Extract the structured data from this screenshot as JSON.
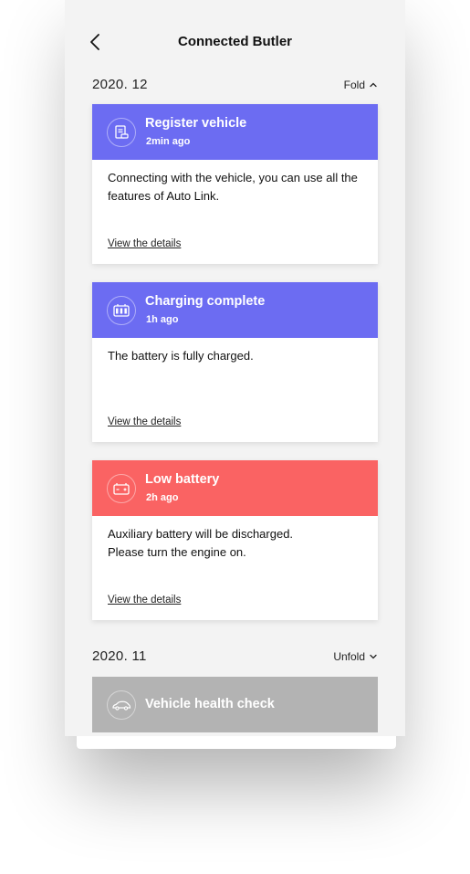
{
  "header": {
    "title": "Connected Butler"
  },
  "sections": [
    {
      "date": "2020. 12",
      "toggle_label": "Fold"
    },
    {
      "date": "2020. 11",
      "toggle_label": "Unfold"
    }
  ],
  "cards": [
    {
      "title": "Register vehicle",
      "time": "2min ago",
      "text": "Connecting with the vehicle, you can use all the features of Auto Link.",
      "link": "View the details",
      "color": "#6c6cf2",
      "icon": "document-car-icon"
    },
    {
      "title": "Charging complete",
      "time": "1h ago",
      "text": "The battery is fully charged.",
      "link": "View the details",
      "color": "#6c6cf2",
      "icon": "battery-full-icon"
    },
    {
      "title": "Low battery",
      "time": "2h ago",
      "text": "Auxiliary battery will be discharged.\nPlease turn the engine on.",
      "link": "View the details",
      "color": "#fa6363",
      "icon": "car-battery-icon"
    }
  ],
  "collapsed_card": {
    "title": "Vehicle health check",
    "color": "#b3b3b3",
    "icon": "car-icon"
  }
}
